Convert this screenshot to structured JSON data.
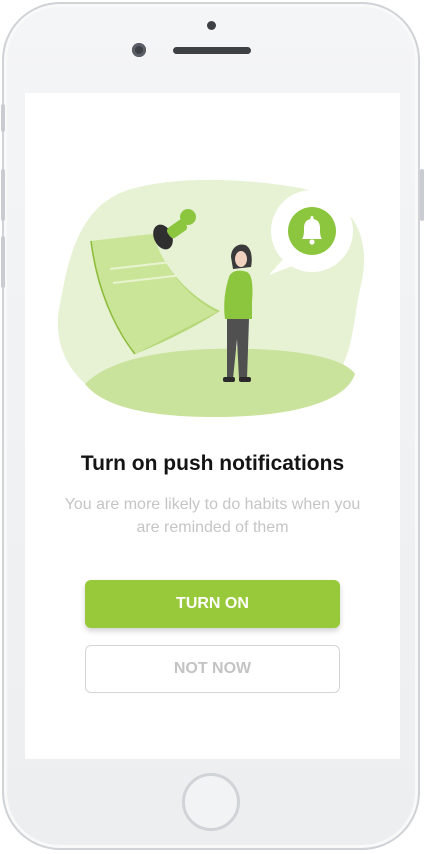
{
  "screen": {
    "title": "Turn on push notifications",
    "subtitle": "You are more likely to do habits when you are reminded of them"
  },
  "actions": {
    "primary_label": "TURN ON",
    "secondary_label": "NOT NOW"
  },
  "colors": {
    "accent": "#97c93a",
    "blob_light": "#e6f2d3",
    "blob_mid": "#c9e29c",
    "text_dark": "#141414",
    "text_muted": "#c5c5c5"
  },
  "illustration": {
    "icons": [
      "bell-icon",
      "pushpin-icon",
      "sticky-note",
      "person-figure"
    ]
  }
}
